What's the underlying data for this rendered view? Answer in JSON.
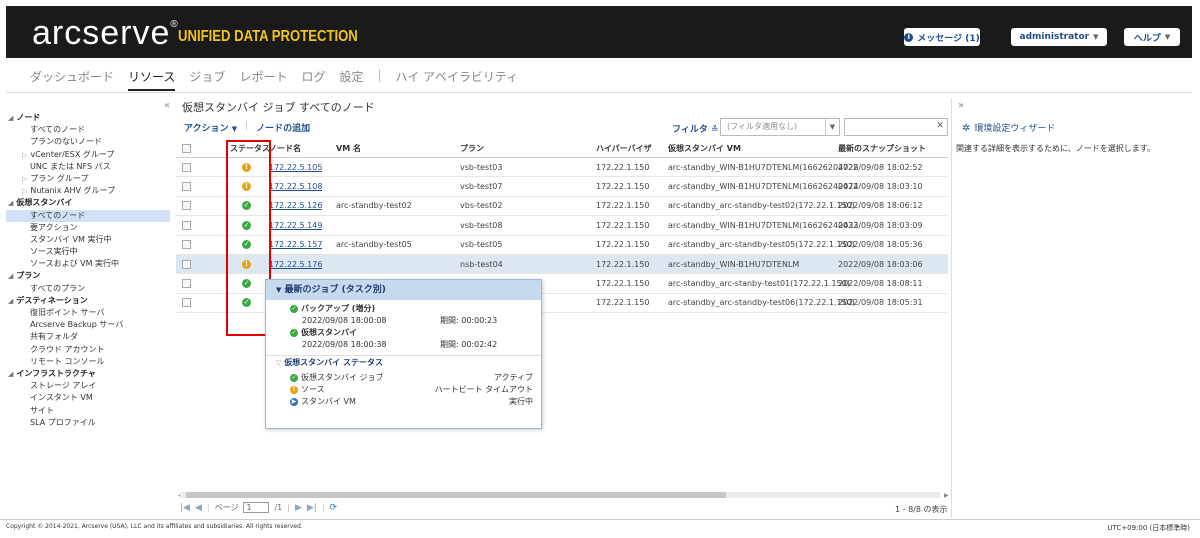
{
  "header": {
    "brand": "arcserve",
    "registered": "®",
    "tagline": "UNIFIED DATA PROTECTION",
    "messages": "メッセージ (1)",
    "user": "administrator",
    "help": "ヘルプ"
  },
  "nav": {
    "tabs": [
      "ダッシュボード",
      "リソース",
      "ジョブ",
      "レポート",
      "ログ",
      "設定"
    ],
    "separator": "|",
    "ha": "ハイ アベイラビリティ"
  },
  "sidebar": {
    "items": [
      {
        "label": "ノード",
        "level": 0,
        "expanded": true
      },
      {
        "label": "すべてのノード",
        "level": 1
      },
      {
        "label": "プランのないノード",
        "level": 1
      },
      {
        "label": "vCenter/ESX グループ",
        "level": 1,
        "collapsed": true
      },
      {
        "label": "UNC または NFS パス",
        "level": 1
      },
      {
        "label": "プラン グループ",
        "level": 1,
        "collapsed": true
      },
      {
        "label": "Nutanix AHV グループ",
        "level": 1,
        "collapsed": true
      },
      {
        "label": "仮想スタンバイ",
        "level": 0,
        "expanded": true
      },
      {
        "label": "すべてのノード",
        "level": 1,
        "selected": true
      },
      {
        "label": "要アクション",
        "level": 1
      },
      {
        "label": "スタンバイ VM 実行中",
        "level": 1
      },
      {
        "label": "ソース実行中",
        "level": 1
      },
      {
        "label": "ソースおよび VM 実行中",
        "level": 1
      },
      {
        "label": "プラン",
        "level": 0,
        "expanded": true
      },
      {
        "label": "すべてのプラン",
        "level": 1
      },
      {
        "label": "デスティネーション",
        "level": 0,
        "expanded": true
      },
      {
        "label": "復旧ポイント サーバ",
        "level": 1
      },
      {
        "label": "Arcserve Backup サーバ",
        "level": 1
      },
      {
        "label": "共有フォルダ",
        "level": 1
      },
      {
        "label": "クラウド アカウント",
        "level": 1
      },
      {
        "label": "リモート コンソール",
        "level": 1
      },
      {
        "label": "インフラストラクチャ",
        "level": 0,
        "expanded": true
      },
      {
        "label": "ストレージ アレイ",
        "level": 1
      },
      {
        "label": "インスタント VM",
        "level": 1
      },
      {
        "label": "サイト",
        "level": 1
      },
      {
        "label": "SLA プロファイル",
        "level": 1
      }
    ]
  },
  "main": {
    "title": "仮想スタンバイ ジョブ すべてのノード",
    "actions": "アクション",
    "add_node": "ノードの追加",
    "filter_label": "フィルタ",
    "filter_value": "(フィルタ適用なし)",
    "columns": {
      "status": "ステータス",
      "node": "ノード名",
      "vm": "VM 名",
      "plan": "プラン",
      "hypervisor": "ハイパーバイザ",
      "standby_vm": "仮想スタンバイ VM",
      "latest_snapshot": "最新のスナップショット"
    },
    "rows": [
      {
        "status": "warn",
        "node": "172.22.5.105",
        "vm": "",
        "plan": "vsb-test03",
        "hypervisor": "172.22.1.150",
        "standby_vm": "arc-standby_WIN-B1HU7DTENLM(16626204728",
        "snapshot": "2022/09/08 18:02:52"
      },
      {
        "status": "warn",
        "node": "172.22.5.108",
        "vm": "",
        "plan": "vsb-test07",
        "hypervisor": "172.22.1.150",
        "standby_vm": "arc-standby_WIN-B1HU7DTENLM(16626240474",
        "snapshot": "2022/09/08 18:03:10"
      },
      {
        "status": "ok",
        "node": "172.22.5.126",
        "vm": "arc-standby-test02",
        "plan": "vbs-test02",
        "hypervisor": "172.22.1.150",
        "standby_vm": "arc-standby_arc-standby-test02(172.22.1.150)",
        "snapshot": "2022/09/08 18:06:12"
      },
      {
        "status": "ok",
        "node": "172.22.5.149",
        "vm": "",
        "plan": "vsb-test08",
        "hypervisor": "172.22.1.150",
        "standby_vm": "arc-standby_WIN-B1HU7DTENLM(16626240433",
        "snapshot": "2022/09/08 18:03:09"
      },
      {
        "status": "ok",
        "node": "172.22.5.157",
        "vm": "arc-standby-test05",
        "plan": "vsb-test05",
        "hypervisor": "172.22.1.150",
        "standby_vm": "arc-standby_arc-standby-test05(172.22.1.150)",
        "snapshot": "2022/09/08 18:05:36"
      },
      {
        "status": "warn",
        "node": "172.22.5.176",
        "vm": "",
        "plan": "nsb-test04",
        "hypervisor": "172.22.1.150",
        "standby_vm": "arc-standby_WIN-B1HU7DTENLM",
        "snapshot": "2022/09/08 18:03:06",
        "selected": true
      },
      {
        "status": "ok",
        "node": "",
        "vm": "",
        "plan": "",
        "hypervisor": "172.22.1.150",
        "standby_vm": "arc-standby_arc-stanby-test01(172.22.1.150)",
        "snapshot": "2022/09/08 18:08:11"
      },
      {
        "status": "ok",
        "node": "",
        "vm": "",
        "plan": "",
        "hypervisor": "172.22.1.150",
        "standby_vm": "arc-standby_arc-standby-test06(172.22.1.150)",
        "snapshot": "2022/09/08 18:05:31"
      }
    ]
  },
  "popup": {
    "latest_jobs_title": "最新のジョブ (タスク別)",
    "backup_label": "バックアップ (増分)",
    "backup_time": "2022/09/08 18:00:08",
    "backup_duration": "期間: 00:00:23",
    "vsb_label": "仮想スタンバイ",
    "vsb_time": "2022/09/08 18:00:38",
    "vsb_duration": "期間: 00:02:42",
    "status_title": "仮想スタンバイ ステータス",
    "status_items": [
      {
        "icon": "ok",
        "label": "仮想スタンバイ ジョブ",
        "value": "アクティブ"
      },
      {
        "icon": "warn",
        "label": "ソース",
        "value": "ハートビート タイムアウト"
      },
      {
        "icon": "play",
        "label": "スタンバイ VM",
        "value": "実行中"
      }
    ]
  },
  "pager": {
    "page_label": "ページ",
    "page": "1",
    "total": "/1",
    "count": "1 - 8/8 の表示"
  },
  "right": {
    "wizard": "環境設定ウィザード",
    "message": "関連する詳細を表示するために、ノードを選択します。"
  },
  "footer": {
    "copyright": "Copyright © 2014-2021, Arcserve (USA), LLC and its affiliates and subsidiaries. All rights reserved.",
    "timezone": "UTC+09:00 (日本標準時)"
  },
  "colors": {
    "header_bg": "#1a1a1a",
    "tagline": "#f0c419",
    "link": "#1f4e8c",
    "warn": "#e8a20c",
    "ok": "#3aa843",
    "highlight": "#e00000"
  }
}
